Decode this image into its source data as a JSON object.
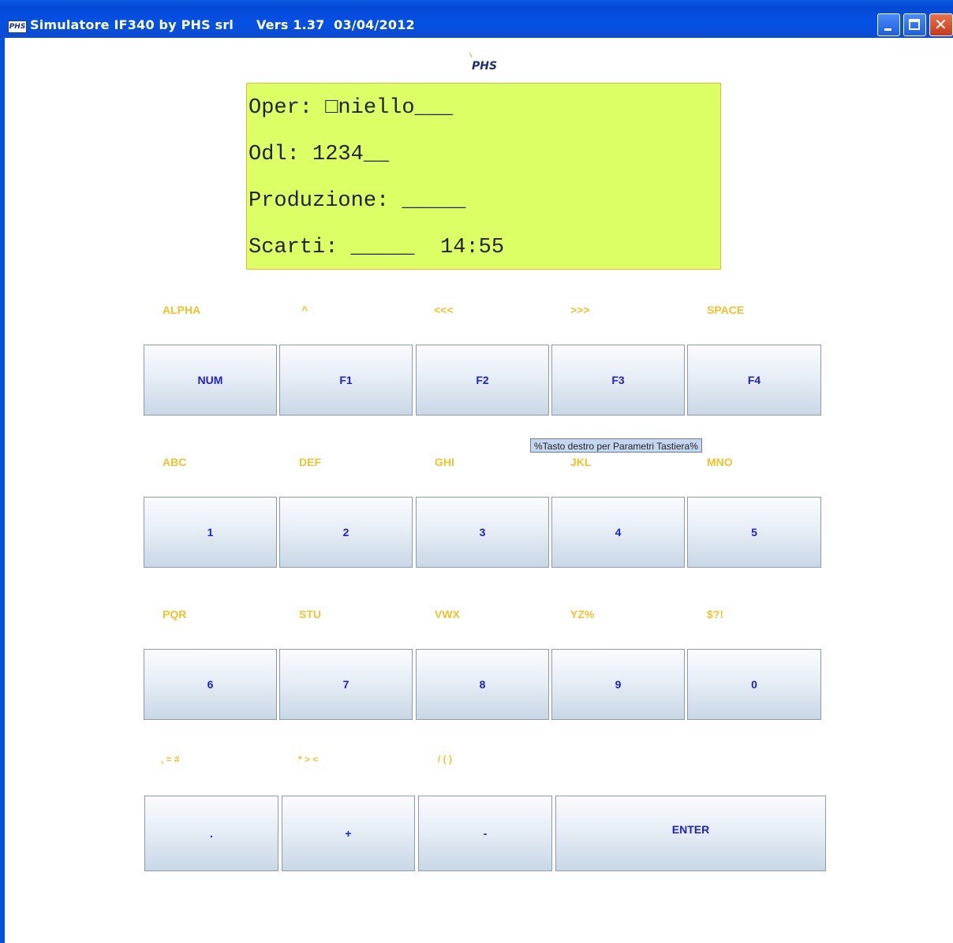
{
  "window": {
    "app_icon_text": "PHS",
    "title": "Simulatore IF340 by PHS srl     Vers 1.37  03/04/2012"
  },
  "logo": {
    "text": "PHS"
  },
  "display": {
    "line1": "Oper: □niello___",
    "line2": "Odl: 1234__",
    "line3": "Produzione: _____",
    "line4": "Scarti: _____  14:55",
    "background": "#ddff66"
  },
  "keypad": {
    "row1_labels": [
      "ALPHA",
      "^",
      "<<<",
      ">>>",
      "SPACE"
    ],
    "row1_keys": [
      "NUM",
      "F1",
      "F2",
      "F3",
      "F4"
    ],
    "row2_labels": [
      "ABC",
      "DEF",
      "GHI",
      "JKL",
      "MNO"
    ],
    "row2_keys": [
      "1",
      "2",
      "3",
      "4",
      "5"
    ],
    "row3_labels": [
      "PQR",
      "STU",
      "VWX",
      "YZ%",
      "$?!"
    ],
    "row3_keys": [
      "6",
      "7",
      "8",
      "9",
      "0"
    ],
    "row4_labels": [
      ", = #",
      "* > <",
      "/ ( )"
    ],
    "row4_keys": [
      ".",
      "+",
      "-",
      "ENTER"
    ],
    "label_color": "#f5c12a",
    "key_text_color": "#1e1ed2"
  },
  "tooltip": {
    "text": "%Tasto destro per Parametri Tastiera%"
  }
}
